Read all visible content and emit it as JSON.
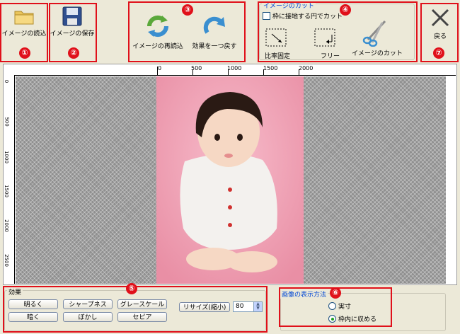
{
  "toolbar": {
    "load_label": "イメージの読込",
    "save_label": "イメージの保存",
    "reload_label": "イメージの再読込",
    "undo_label": "効果を一つ戻す",
    "back_label": "戻る"
  },
  "cut": {
    "group_title": "イメージのカット",
    "circle_checkbox_label": "枠に接地する円でカット",
    "ratio_fixed_label": "比率固定",
    "free_label": "フリー",
    "cut_label": "イメージのカット"
  },
  "ruler": {
    "top_ticks": [
      "0",
      "500",
      "1000",
      "1500",
      "2000"
    ],
    "left_ticks": [
      "0",
      "500",
      "1000",
      "1500",
      "2000",
      "2500"
    ]
  },
  "effects": {
    "group_title": "効果",
    "brighten": "明るく",
    "sharpness": "シャープネス",
    "grayscale": "グレースケール",
    "darken": "暗く",
    "blur": "ぼかし",
    "sepia": "セピア",
    "resize_label": "リサイズ(縮小)",
    "resize_value": "80"
  },
  "display": {
    "group_title": "画像の表示方法",
    "actual_size": "実寸",
    "fit_in_frame": "枠内に収める",
    "selected": "fit_in_frame"
  },
  "markers": [
    "①",
    "②",
    "③",
    "④",
    "⑤",
    "⑥",
    "⑦"
  ],
  "colors": {
    "accent_red": "#e0101a",
    "group_title_blue": "#0046d5",
    "photo_bg": "#f2a8b8"
  }
}
